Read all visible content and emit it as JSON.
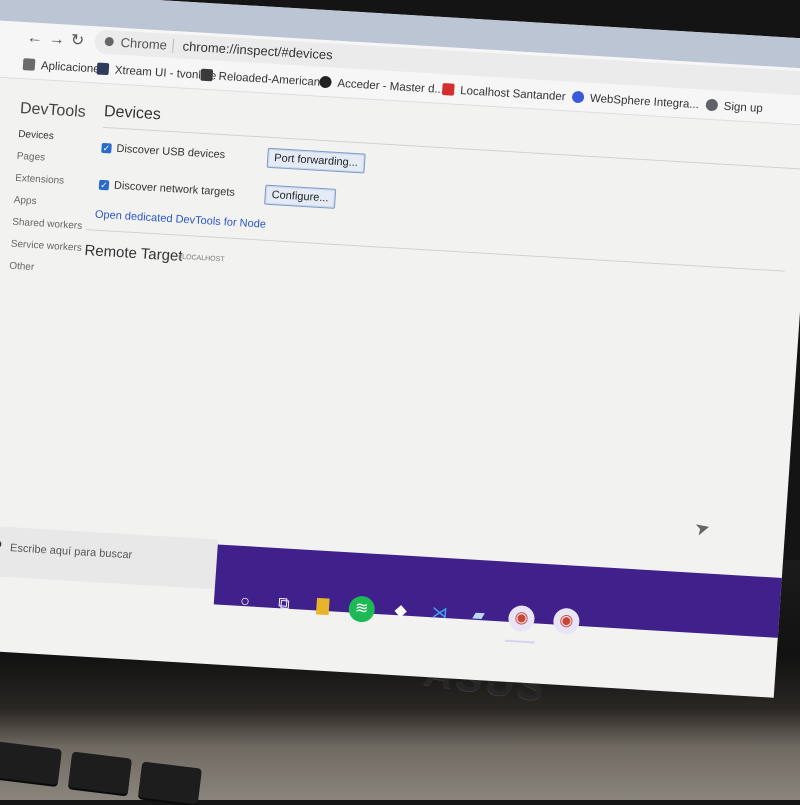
{
  "browser": {
    "omnibox_site": "Chrome",
    "omnibox_url": "chrome://inspect/#devices",
    "bookmarks": [
      {
        "label": "Aplicaciones",
        "icon": "apps-grid-icon",
        "color": "#6b6b6b"
      },
      {
        "label": "Xtream UI - tvonline",
        "icon": "bookmark-icon",
        "color": "#2e3b5c"
      },
      {
        "label": "Reloaded-American...",
        "icon": "bookmark-icon",
        "color": "#3a3a3a"
      },
      {
        "label": "Acceder - Master d...",
        "icon": "bookmark-icon",
        "color": "#222222"
      },
      {
        "label": "Localhost Santander",
        "icon": "warning-icon",
        "color": "#d32f2f"
      },
      {
        "label": "WebSphere Integra...",
        "icon": "globe-icon",
        "color": "#3a5bd9"
      },
      {
        "label": "Sign up",
        "icon": "google-g-icon",
        "color": "#5f6368"
      }
    ]
  },
  "inspect": {
    "sidebar_title": "DevTools",
    "sidebar_items": [
      "Devices",
      "Pages",
      "Extensions",
      "Apps",
      "Shared workers",
      "Service workers",
      "Other"
    ],
    "page_title": "Devices",
    "usb_label": "Discover USB devices",
    "network_label": "Discover network targets",
    "port_forwarding_label": "Port forwarding...",
    "configure_label": "Configure...",
    "node_link": "Open dedicated DevTools for Node",
    "remote_target_title": "Remote Target",
    "remote_target_sub": "#LOCALHOST",
    "usb_checked": true,
    "network_checked": true
  },
  "taskbar": {
    "search_placeholder": "Escribe aquí para buscar",
    "apps": [
      {
        "name": "cortana-icon",
        "glyph": "○",
        "color": "#40208a"
      },
      {
        "name": "task-view-icon",
        "glyph": "⧉",
        "color": "#40208a"
      },
      {
        "name": "file-explorer-icon",
        "glyph": "▇",
        "color": "#e8b52a"
      },
      {
        "name": "spotify-icon",
        "glyph": "≋",
        "color": "#1db954"
      },
      {
        "name": "git-icon",
        "glyph": "◆",
        "color": "#40208a"
      },
      {
        "name": "vscode-icon",
        "glyph": "⋊",
        "color": "#0a7ad6"
      },
      {
        "name": "app-icon",
        "glyph": "▰",
        "color": "#40208a"
      },
      {
        "name": "chrome-icon",
        "glyph": "◉",
        "color": "#cc4433"
      },
      {
        "name": "chrome-icon",
        "glyph": "◉",
        "color": "#cc4433"
      }
    ]
  },
  "laptop": {
    "brand": "ASUS"
  },
  "colors": {
    "accent": "#2a6ac9",
    "taskbar": "#40208a",
    "link": "#2b56c7"
  }
}
